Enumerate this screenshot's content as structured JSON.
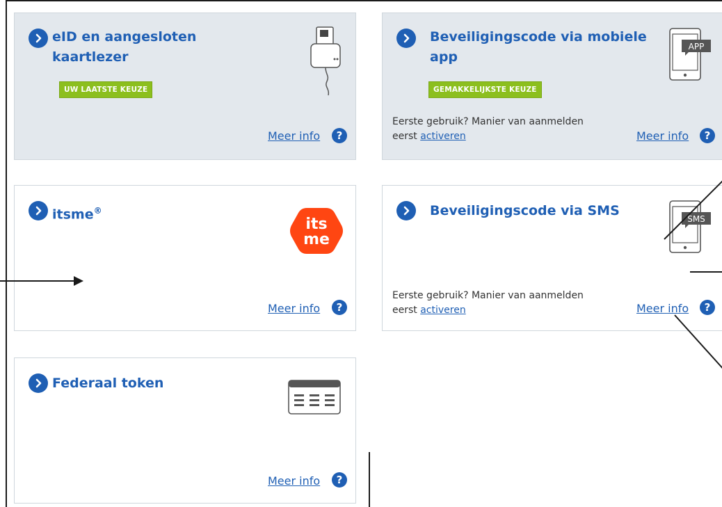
{
  "cards": {
    "eid": {
      "title_line1": "eID en aangesloten",
      "title_line2": "kaartlezer",
      "badge": "UW LAATSTE KEUZE",
      "more_info": "Meer info",
      "help": "?"
    },
    "mobile_app": {
      "title_line1": "Beveiligingscode via mobiele",
      "title_line2": "app",
      "badge": "GEMAKKELIJKSTE KEUZE",
      "note_line1": "Eerste gebruik? Manier van aanmelden",
      "note_prefix": "eerst",
      "note_link": "activeren",
      "more_info": "Meer info",
      "help": "?",
      "icon_label": "APP"
    },
    "itsme": {
      "title": "itsme",
      "title_mark": "®",
      "logo_line1": "its",
      "logo_line2": "me",
      "more_info": "Meer info",
      "help": "?"
    },
    "sms": {
      "title": "Beveiligingscode via SMS",
      "note_line1": "Eerste gebruik? Manier van aanmelden",
      "note_prefix": "eerst",
      "note_link": "activeren",
      "more_info": "Meer info",
      "help": "?",
      "icon_label": "SMS"
    },
    "token": {
      "title": "Federaal token",
      "more_info": "Meer info",
      "help": "?"
    }
  },
  "colors": {
    "accent": "#1f5fb4",
    "badge_green": "#8cbf1e",
    "card_grey": "#e3e8ed",
    "itsme_orange": "#ff4612"
  },
  "icons": [
    "chevron-right-icon",
    "card-reader-icon",
    "phone-app-icon",
    "itsme-logo",
    "phone-sms-icon",
    "token-icon",
    "help-icon"
  ]
}
